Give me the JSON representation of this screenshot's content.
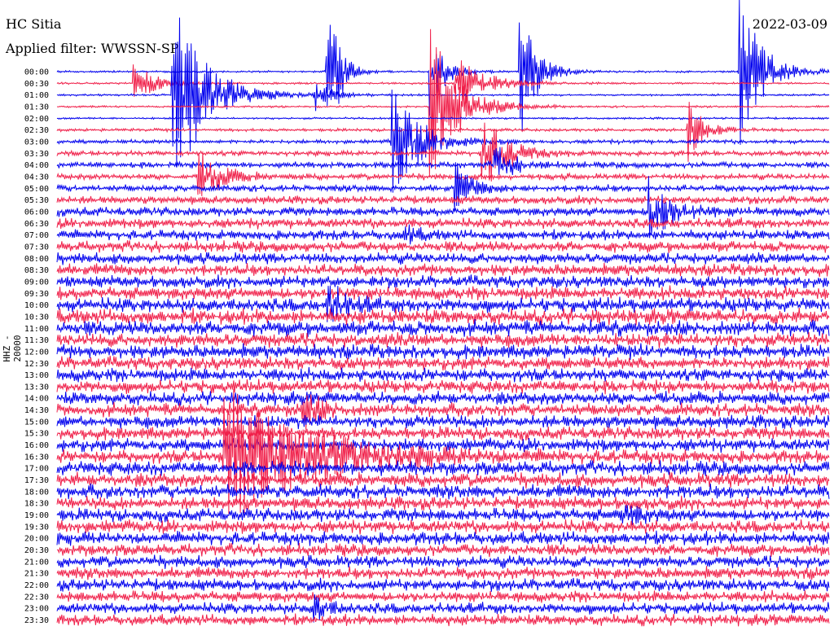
{
  "header": {
    "station": "HC Sitia",
    "filter": "Applied filter: WWSSN-SP",
    "date": "2022-03-09"
  },
  "chart_data": {
    "type": "line",
    "title": "HC Sitia",
    "subtitle": "Applied filter: WWSSN-SP",
    "date": "2022-03-09",
    "channel_label": "HHZ - 20000",
    "row_labels": [
      "00:00",
      "00:30",
      "01:00",
      "01:30",
      "02:00",
      "02:30",
      "03:00",
      "03:30",
      "04:00",
      "04:30",
      "05:00",
      "05:30",
      "06:00",
      "06:30",
      "07:00",
      "07:30",
      "08:00",
      "08:30",
      "09:00",
      "09:30",
      "10:00",
      "10:30",
      "11:00",
      "11:30",
      "12:00",
      "12:30",
      "13:00",
      "13:30",
      "14:00",
      "14:30",
      "15:00",
      "15:30",
      "16:00",
      "16:30",
      "17:00",
      "17:30",
      "18:00",
      "18:30",
      "19:00",
      "19:30",
      "20:00",
      "20:30",
      "21:00",
      "21:30",
      "22:00",
      "22:30",
      "23:00",
      "23:30"
    ],
    "row_minutes": 30,
    "series_colors": [
      "#0000ee",
      "#f0204a"
    ],
    "noise_amplitude_by_row": [
      1,
      1,
      1,
      1,
      1,
      1.5,
      2,
      2.5,
      3,
      3,
      3.5,
      4,
      4.5,
      5,
      5,
      5.5,
      5.5,
      6,
      6,
      6.5,
      7,
      7.5,
      7.5,
      7,
      7,
      6.5,
      6.5,
      6.5,
      6.5,
      6.5,
      6.5,
      6.5,
      6.5,
      6.5,
      7,
      7,
      7,
      6.5,
      6.5,
      6.5,
      6.5,
      6,
      6,
      6,
      6,
      5.5,
      5.5,
      5.5
    ],
    "events": [
      {
        "row": 0,
        "minute": 10.5,
        "amplitude": 120,
        "decay_min": 0.4
      },
      {
        "row": 0,
        "minute": 14.5,
        "amplitude": 60,
        "decay_min": 0.5
      },
      {
        "row": 0,
        "minute": 18.0,
        "amplitude": 90,
        "decay_min": 0.6
      },
      {
        "row": 0,
        "minute": 26.5,
        "amplitude": 110,
        "decay_min": 0.8
      },
      {
        "row": 1,
        "minute": 3.0,
        "amplitude": 25,
        "decay_min": 0.8
      },
      {
        "row": 1,
        "minute": 15.5,
        "amplitude": 40,
        "decay_min": 1.0
      },
      {
        "row": 2,
        "minute": 4.5,
        "amplitude": 120,
        "decay_min": 1.2
      },
      {
        "row": 2,
        "minute": 10.0,
        "amplitude": 20,
        "decay_min": 0.6
      },
      {
        "row": 3,
        "minute": 14.5,
        "amplitude": 100,
        "decay_min": 1.0
      },
      {
        "row": 5,
        "minute": 24.5,
        "amplitude": 40,
        "decay_min": 0.6
      },
      {
        "row": 6,
        "minute": 13.0,
        "amplitude": 70,
        "decay_min": 1.0
      },
      {
        "row": 7,
        "minute": 16.5,
        "amplitude": 60,
        "decay_min": 0.8
      },
      {
        "row": 8,
        "minute": 17.0,
        "amplitude": 30,
        "decay_min": 0.6
      },
      {
        "row": 9,
        "minute": 5.5,
        "amplitude": 35,
        "decay_min": 0.8
      },
      {
        "row": 10,
        "minute": 15.5,
        "amplitude": 30,
        "decay_min": 0.6
      },
      {
        "row": 12,
        "minute": 23.0,
        "amplitude": 45,
        "decay_min": 0.8
      },
      {
        "row": 14,
        "minute": 13.5,
        "amplitude": 12,
        "decay_min": 0.5
      },
      {
        "row": 20,
        "minute": 10.5,
        "amplitude": 30,
        "decay_min": 0.6
      },
      {
        "row": 29,
        "minute": 9.5,
        "amplitude": 28,
        "decay_min": 0.6
      },
      {
        "row": 33,
        "minute": 6.5,
        "amplitude": 90,
        "decay_min": 3.0
      },
      {
        "row": 38,
        "minute": 22.0,
        "amplitude": 18,
        "decay_min": 0.5
      },
      {
        "row": 46,
        "minute": 10.0,
        "amplitude": 18,
        "decay_min": 0.5
      }
    ]
  }
}
